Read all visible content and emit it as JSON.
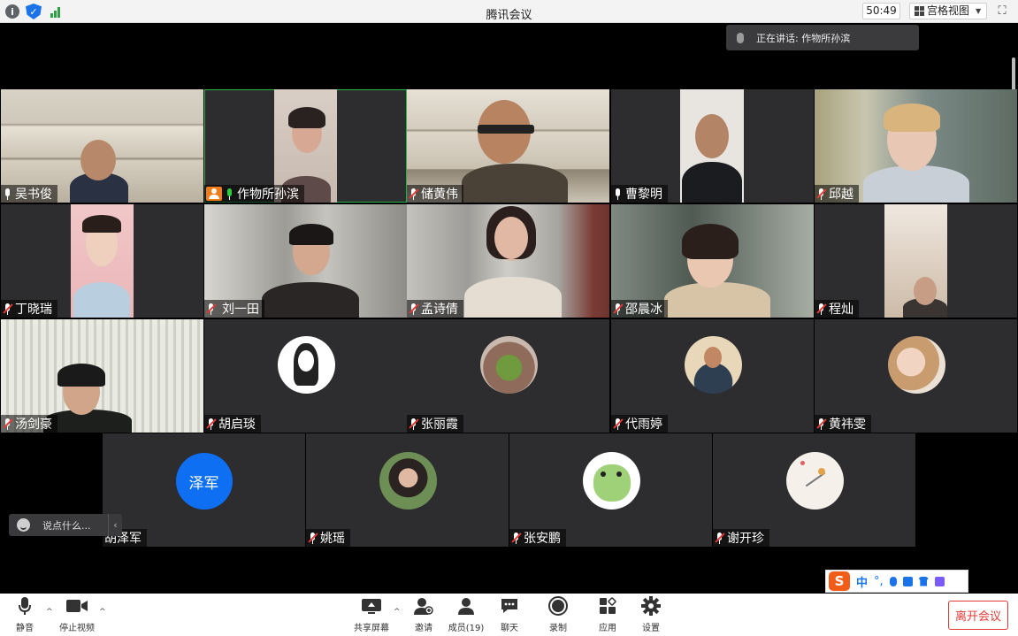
{
  "window": {
    "title": "腾讯会议",
    "timer": "50:49",
    "view_label": "宫格视图"
  },
  "speaking": {
    "label": "正在讲话: 作物所孙滨"
  },
  "participants": [
    {
      "name": "吴书俊",
      "mic": "on"
    },
    {
      "name": "作物所孙滨",
      "mic": "speaking",
      "host": true
    },
    {
      "name": "储黄伟",
      "mic": "muted"
    },
    {
      "name": "曹黎明",
      "mic": "on"
    },
    {
      "name": "邱越",
      "mic": "muted"
    },
    {
      "name": "丁晓瑞",
      "mic": "muted"
    },
    {
      "name": "刘一田",
      "mic": "muted"
    },
    {
      "name": "孟诗倩",
      "mic": "muted"
    },
    {
      "name": "邵晨冰",
      "mic": "muted"
    },
    {
      "name": "程灿",
      "mic": "muted"
    },
    {
      "name": "汤剑豪",
      "mic": "muted"
    },
    {
      "name": "胡启琰",
      "mic": "muted"
    },
    {
      "name": "张丽霞",
      "mic": "muted"
    },
    {
      "name": "代雨婷",
      "mic": "muted"
    },
    {
      "name": "黄祎雯",
      "mic": "muted"
    },
    {
      "name": "胡泽军",
      "mic": "none",
      "avatar_text": "泽军"
    },
    {
      "name": "姚瑶",
      "mic": "muted"
    },
    {
      "name": "张安鹏",
      "mic": "muted"
    },
    {
      "name": "谢开珍",
      "mic": "muted"
    }
  ],
  "chat": {
    "placeholder": "说点什么..."
  },
  "ime": {
    "logo": "S",
    "lang": "中",
    "punct": "°,"
  },
  "toolbar": {
    "mute": "静音",
    "stop_video": "停止视频",
    "share_screen": "共享屏幕",
    "invite": "邀请",
    "members": "成员(19)",
    "chat": "聊天",
    "record": "录制",
    "apps": "应用",
    "settings": "设置",
    "leave": "离开会议"
  },
  "colors": {
    "accent_blue": "#0e6ff2",
    "leave_red": "#e53935",
    "active_green": "#28b446"
  }
}
